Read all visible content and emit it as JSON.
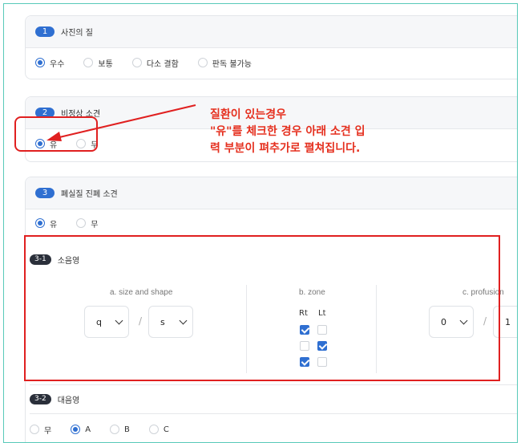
{
  "section1": {
    "number": "1",
    "title": "사진의 질",
    "options": [
      "우수",
      "보통",
      "다소 결함",
      "판독 불가능"
    ],
    "selected": "우수"
  },
  "section2": {
    "number": "2",
    "title": "비정상 소견",
    "options": [
      "유",
      "무"
    ],
    "selected": "유"
  },
  "section3": {
    "number": "3",
    "title": "폐실질 진폐 소견",
    "options": [
      "유",
      "무"
    ],
    "selected": "유"
  },
  "sub31": {
    "number": "3-1",
    "title": "소음영",
    "size_shape_label": "a. size and shape",
    "size_value": "q",
    "shape_value": "s",
    "zone_label": "b. zone",
    "rt_label": "Rt",
    "lt_label": "Lt",
    "zone_checks": [
      {
        "rt": true,
        "lt": false
      },
      {
        "rt": false,
        "lt": true
      },
      {
        "rt": true,
        "lt": false
      }
    ],
    "profusion_label": "c. profusion",
    "profusion_value": "0",
    "profusion_value2": "1",
    "separator": "/"
  },
  "sub32": {
    "number": "3-2",
    "title": "대음영",
    "options": [
      "무",
      "A",
      "B",
      "C"
    ],
    "selected": "A"
  },
  "annotation": {
    "line1": "질환이 있는경우",
    "line2": "\"유\"를 체크한 경우 아래 소견 입",
    "line3": "력 부분이 펴추가로 펼쳐집니다.",
    "color": "#e5301f"
  },
  "colors": {
    "accent": "#2f6fd1",
    "frame": "#58c9b9",
    "annotation_red": "#e02020"
  }
}
